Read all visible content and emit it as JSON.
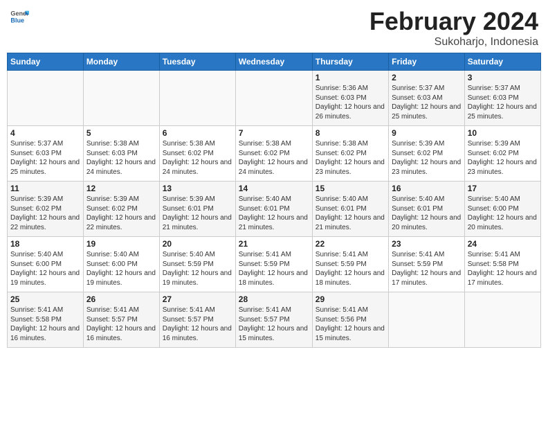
{
  "header": {
    "logo_general": "General",
    "logo_blue": "Blue",
    "title": "February 2024",
    "location": "Sukoharjo, Indonesia"
  },
  "weekdays": [
    "Sunday",
    "Monday",
    "Tuesday",
    "Wednesday",
    "Thursday",
    "Friday",
    "Saturday"
  ],
  "weeks": [
    [
      {
        "day": "",
        "info": ""
      },
      {
        "day": "",
        "info": ""
      },
      {
        "day": "",
        "info": ""
      },
      {
        "day": "",
        "info": ""
      },
      {
        "day": "1",
        "info": "Sunrise: 5:36 AM\nSunset: 6:03 PM\nDaylight: 12 hours and 26 minutes."
      },
      {
        "day": "2",
        "info": "Sunrise: 5:37 AM\nSunset: 6:03 AM\nDaylight: 12 hours and 25 minutes."
      },
      {
        "day": "3",
        "info": "Sunrise: 5:37 AM\nSunset: 6:03 PM\nDaylight: 12 hours and 25 minutes."
      }
    ],
    [
      {
        "day": "4",
        "info": "Sunrise: 5:37 AM\nSunset: 6:03 PM\nDaylight: 12 hours and 25 minutes."
      },
      {
        "day": "5",
        "info": "Sunrise: 5:38 AM\nSunset: 6:03 PM\nDaylight: 12 hours and 24 minutes."
      },
      {
        "day": "6",
        "info": "Sunrise: 5:38 AM\nSunset: 6:02 PM\nDaylight: 12 hours and 24 minutes."
      },
      {
        "day": "7",
        "info": "Sunrise: 5:38 AM\nSunset: 6:02 PM\nDaylight: 12 hours and 24 minutes."
      },
      {
        "day": "8",
        "info": "Sunrise: 5:38 AM\nSunset: 6:02 PM\nDaylight: 12 hours and 23 minutes."
      },
      {
        "day": "9",
        "info": "Sunrise: 5:39 AM\nSunset: 6:02 PM\nDaylight: 12 hours and 23 minutes."
      },
      {
        "day": "10",
        "info": "Sunrise: 5:39 AM\nSunset: 6:02 PM\nDaylight: 12 hours and 23 minutes."
      }
    ],
    [
      {
        "day": "11",
        "info": "Sunrise: 5:39 AM\nSunset: 6:02 PM\nDaylight: 12 hours and 22 minutes."
      },
      {
        "day": "12",
        "info": "Sunrise: 5:39 AM\nSunset: 6:02 PM\nDaylight: 12 hours and 22 minutes."
      },
      {
        "day": "13",
        "info": "Sunrise: 5:39 AM\nSunset: 6:01 PM\nDaylight: 12 hours and 21 minutes."
      },
      {
        "day": "14",
        "info": "Sunrise: 5:40 AM\nSunset: 6:01 PM\nDaylight: 12 hours and 21 minutes."
      },
      {
        "day": "15",
        "info": "Sunrise: 5:40 AM\nSunset: 6:01 PM\nDaylight: 12 hours and 21 minutes."
      },
      {
        "day": "16",
        "info": "Sunrise: 5:40 AM\nSunset: 6:01 PM\nDaylight: 12 hours and 20 minutes."
      },
      {
        "day": "17",
        "info": "Sunrise: 5:40 AM\nSunset: 6:00 PM\nDaylight: 12 hours and 20 minutes."
      }
    ],
    [
      {
        "day": "18",
        "info": "Sunrise: 5:40 AM\nSunset: 6:00 PM\nDaylight: 12 hours and 19 minutes."
      },
      {
        "day": "19",
        "info": "Sunrise: 5:40 AM\nSunset: 6:00 PM\nDaylight: 12 hours and 19 minutes."
      },
      {
        "day": "20",
        "info": "Sunrise: 5:40 AM\nSunset: 5:59 PM\nDaylight: 12 hours and 19 minutes."
      },
      {
        "day": "21",
        "info": "Sunrise: 5:41 AM\nSunset: 5:59 PM\nDaylight: 12 hours and 18 minutes."
      },
      {
        "day": "22",
        "info": "Sunrise: 5:41 AM\nSunset: 5:59 PM\nDaylight: 12 hours and 18 minutes."
      },
      {
        "day": "23",
        "info": "Sunrise: 5:41 AM\nSunset: 5:59 PM\nDaylight: 12 hours and 17 minutes."
      },
      {
        "day": "24",
        "info": "Sunrise: 5:41 AM\nSunset: 5:58 PM\nDaylight: 12 hours and 17 minutes."
      }
    ],
    [
      {
        "day": "25",
        "info": "Sunrise: 5:41 AM\nSunset: 5:58 PM\nDaylight: 12 hours and 16 minutes."
      },
      {
        "day": "26",
        "info": "Sunrise: 5:41 AM\nSunset: 5:57 PM\nDaylight: 12 hours and 16 minutes."
      },
      {
        "day": "27",
        "info": "Sunrise: 5:41 AM\nSunset: 5:57 PM\nDaylight: 12 hours and 16 minutes."
      },
      {
        "day": "28",
        "info": "Sunrise: 5:41 AM\nSunset: 5:57 PM\nDaylight: 12 hours and 15 minutes."
      },
      {
        "day": "29",
        "info": "Sunrise: 5:41 AM\nSunset: 5:56 PM\nDaylight: 12 hours and 15 minutes."
      },
      {
        "day": "",
        "info": ""
      },
      {
        "day": "",
        "info": ""
      }
    ]
  ]
}
